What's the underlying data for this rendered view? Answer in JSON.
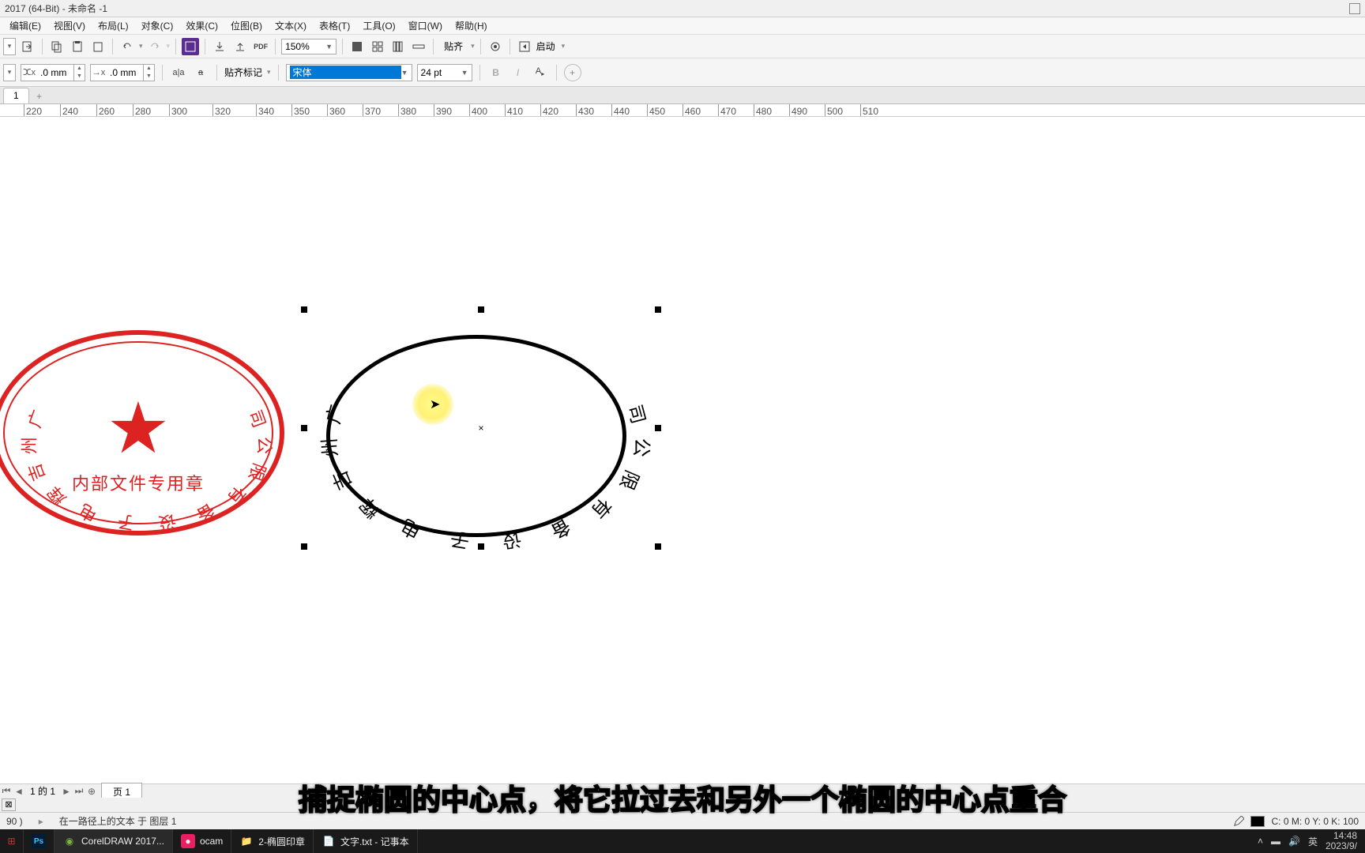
{
  "titlebar": {
    "title": "2017 (64-Bit) - 未命名 -1"
  },
  "menus": [
    "编辑(E)",
    "视图(V)",
    "布局(L)",
    "对象(C)",
    "效果(C)",
    "位图(B)",
    "文本(X)",
    "表格(T)",
    "工具(O)",
    "窗口(W)",
    "帮助(H)"
  ],
  "toolbar1": {
    "zoom": "150%",
    "snap_label": "贴齐",
    "launch": "启动"
  },
  "toolbar2": {
    "offsetX_label": "ⵋx",
    "offsetX": ".0 mm",
    "offsetY_label": "→x",
    "offsetY": ".0 mm",
    "snapmark_label": "贴齐标记",
    "font": "宋体",
    "fontsize": "24 pt",
    "bold": "B",
    "italic": "I"
  },
  "tabs": {
    "t1": "1"
  },
  "ruler_marks": [
    220,
    260,
    300,
    340,
    380,
    440,
    490,
    530,
    580,
    625,
    670,
    715,
    760,
    805,
    850,
    895,
    940,
    990,
    1035,
    1080,
    1125,
    1170,
    1215,
    1260,
    1305,
    1350
  ],
  "ruler_values": [
    "220",
    "240",
    "260",
    "280",
    "300",
    "320",
    "340",
    "350",
    "360",
    "370",
    "380",
    "390",
    "400",
    "410",
    "420",
    "430",
    "440",
    "450",
    "460",
    "470",
    "480",
    "490",
    "500",
    "510"
  ],
  "red_stamp": {
    "arc_text": "广州吉辉电子设备有限公司",
    "bottom_text": "内部文件专用章"
  },
  "black_ellipse": {
    "arc_text": "广州吉辉电子设备有限公司"
  },
  "pagenav": {
    "info": "1 的 1",
    "page_tab": "页 1"
  },
  "status": {
    "left1": "90 )",
    "left2": "在一路径上的文本 于 图层 1",
    "right": "C: 0 M: 0 Y: 0 K: 100"
  },
  "subtitle": "捕捉椭圆的中心点，将它拉过去和另外一个椭圆的中心点重合",
  "taskbar": {
    "items": [
      {
        "icon": "ps",
        "label": ""
      },
      {
        "icon": "corel",
        "label": "CorelDRAW 2017..."
      },
      {
        "icon": "ocam",
        "label": "ocam"
      },
      {
        "icon": "folder",
        "label": "2-椭圆印章"
      },
      {
        "icon": "notepad",
        "label": "文字.txt - 记事本"
      }
    ],
    "ime": "英",
    "time": "14:48",
    "date": "2023/9/"
  }
}
